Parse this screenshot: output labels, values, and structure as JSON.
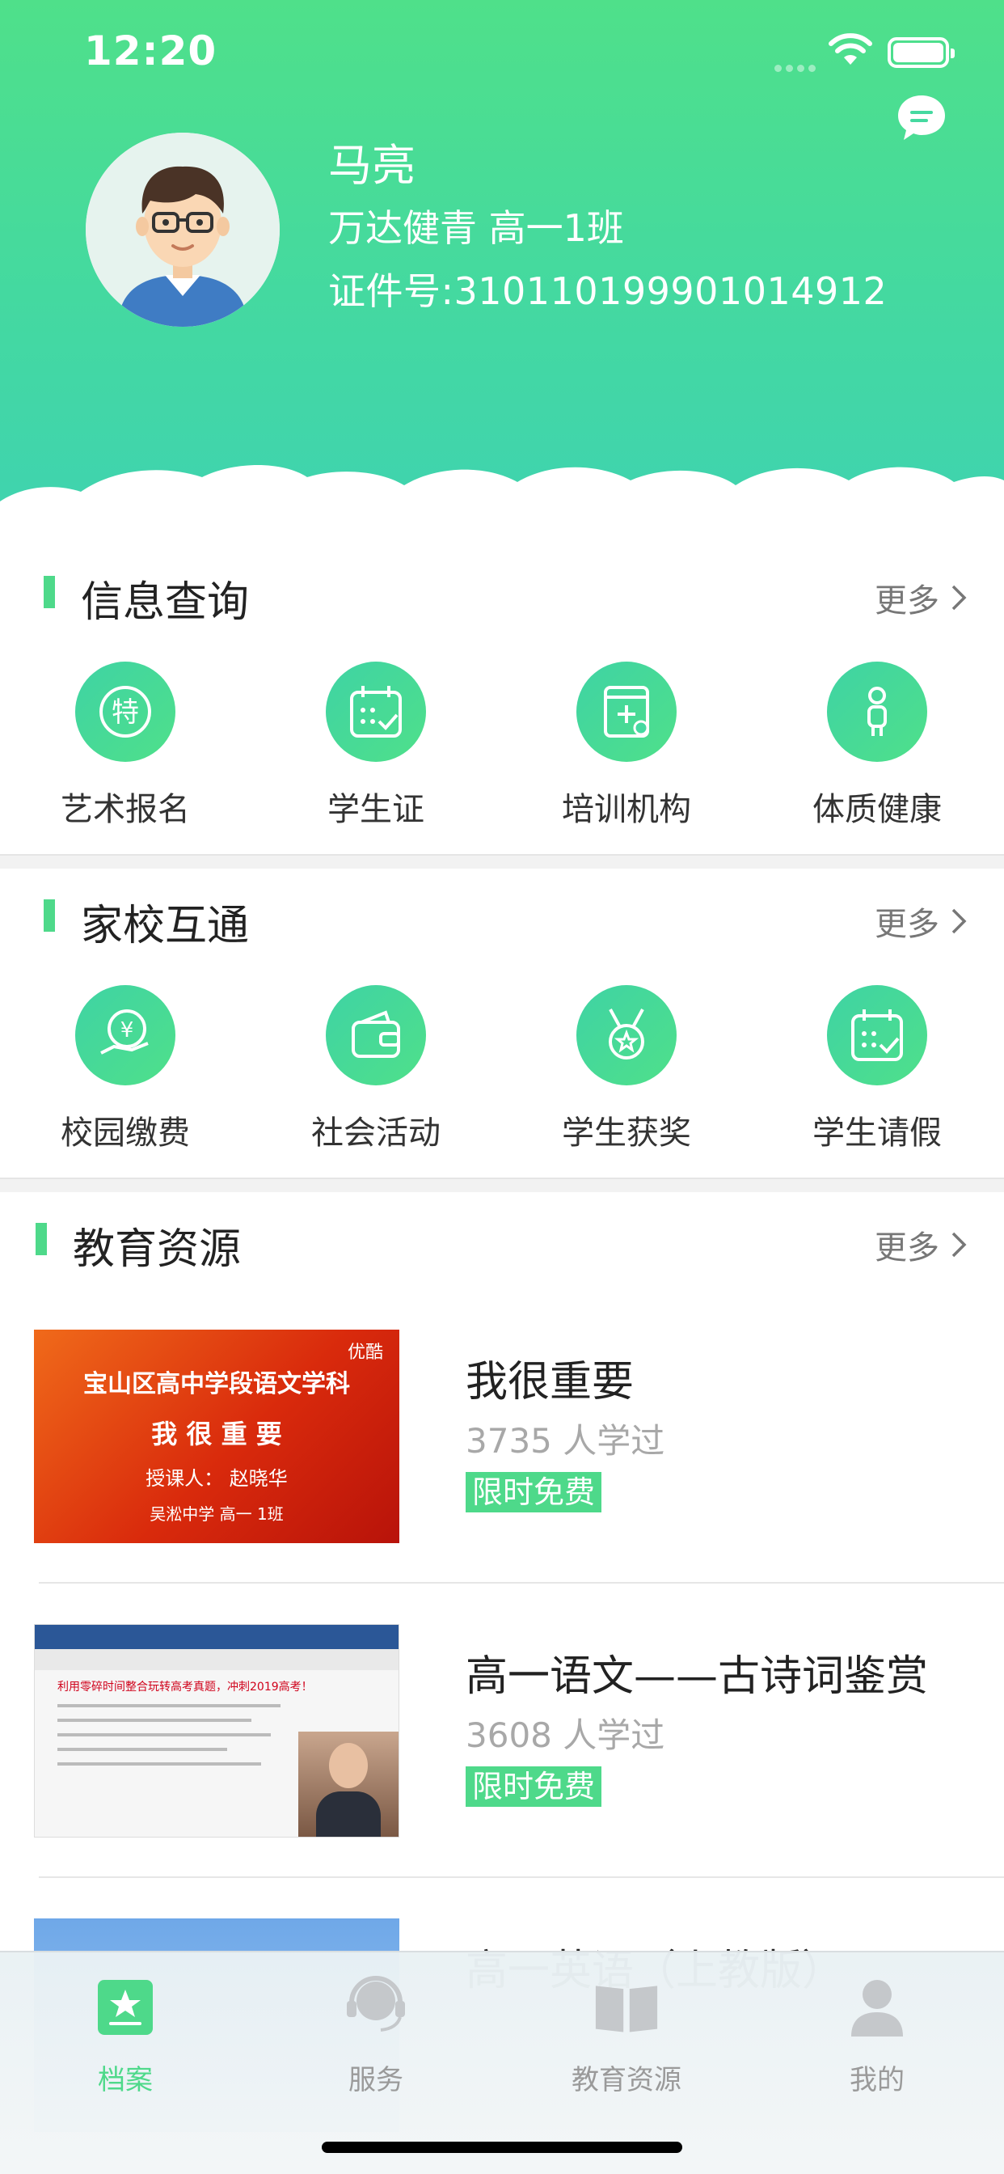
{
  "status_bar": {
    "time": "12:20"
  },
  "profile": {
    "name": "马亮",
    "school_class": "万达健青 高一1班",
    "id_number": "证件号:310110199901014912",
    "avatar_icon": "student-avatar"
  },
  "colors": {
    "accent": "#4ED98A",
    "header_top": "#4FE08A",
    "header_bottom": "#3FD3B0"
  },
  "sections": {
    "info_query": {
      "title": "信息查询",
      "more": "更多",
      "items": [
        {
          "label": "艺术报名",
          "icon": "special-badge-icon"
        },
        {
          "label": "学生证",
          "icon": "calendar-check-icon"
        },
        {
          "label": "培训机构",
          "icon": "medical-book-icon"
        },
        {
          "label": "体质健康",
          "icon": "person-icon"
        }
      ]
    },
    "home_school": {
      "title": "家校互通",
      "more": "更多",
      "items": [
        {
          "label": "校园缴费",
          "icon": "yen-hand-icon"
        },
        {
          "label": "社会活动",
          "icon": "wallet-icon"
        },
        {
          "label": "学生获奖",
          "icon": "medal-icon"
        },
        {
          "label": "学生请假",
          "icon": "calendar-check-icon"
        }
      ]
    },
    "edu_resources": {
      "title": "教育资源",
      "more": "更多",
      "items": [
        {
          "title": "我很重要",
          "count": "3735 人学过",
          "tag": "限时免费",
          "thumb": {
            "logo": "优酷",
            "line1": "宝山区高中学段语文学科",
            "line2": "我 很 重 要",
            "line3": "授课人： 赵晓华",
            "line4": "吴淞中学 高一 1班"
          }
        },
        {
          "title": "高一语文——古诗词鉴赏",
          "count": "3608 人学过",
          "tag": "限时免费",
          "thumb": {
            "line1": "利用零碎时间整合玩转高考真题，冲刺2019高考！"
          }
        },
        {
          "title": "高一英语（上教版）",
          "count": "",
          "tag": "",
          "thumb": {}
        }
      ]
    }
  },
  "tab_bar": [
    {
      "label": "档案",
      "icon": "archive-star-icon",
      "active": true
    },
    {
      "label": "服务",
      "icon": "service-headset-icon",
      "active": false
    },
    {
      "label": "教育资源",
      "icon": "open-book-icon",
      "active": false
    },
    {
      "label": "我的",
      "icon": "user-icon",
      "active": false
    }
  ]
}
